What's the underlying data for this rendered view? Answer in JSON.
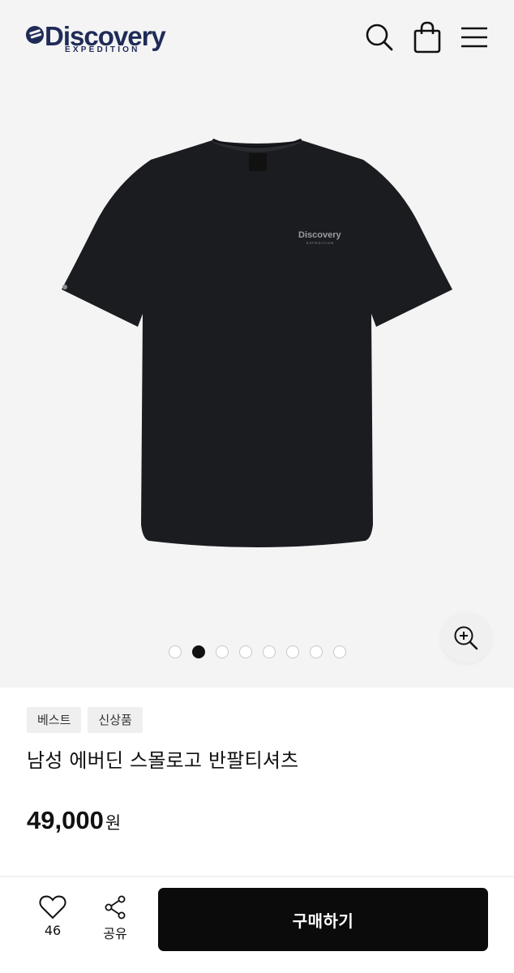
{
  "header": {
    "brand": "Discovery",
    "brand_sub": "EXPEDITION",
    "icons": [
      "search-icon",
      "shopping-bag-icon",
      "menu-icon"
    ]
  },
  "gallery": {
    "image": "black-tshirt",
    "shirt_print": "Discovery",
    "shirt_print_sub": "EXPEDITION",
    "slide_count": 8,
    "active_slide": 2,
    "zoom_icon": "zoom-in-icon"
  },
  "product": {
    "badges": [
      "베스트",
      "신상품"
    ],
    "name": "남성 에버딘 스몰로고 반팔티셔츠",
    "price": "49,000",
    "currency": "원"
  },
  "actions": {
    "like_count": "46",
    "share_label": "공유",
    "buy_label": "구매하기"
  },
  "colors": {
    "brand": "#1f2b57",
    "buy_button": "#0b0b0b",
    "gallery_bg": "#f4f4f5"
  }
}
